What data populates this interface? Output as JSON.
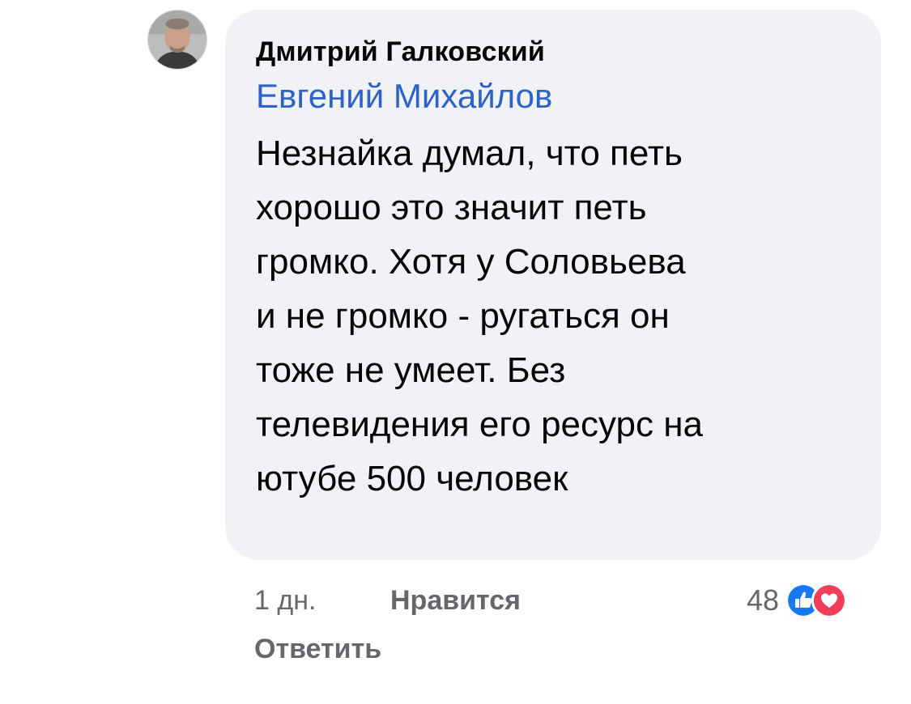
{
  "comment": {
    "author": "Дмитрий Галковский",
    "mention": "Евгений Михайлов",
    "text": "Незнайка думал, что петь\nхорошо это значит петь\nгромко. Хотя у Соловьева\nи не громко - ругаться он\nтоже не умеет. Без\nтелевидения его ресурс на\nютубе 500 человек"
  },
  "meta": {
    "time": "1 дн.",
    "like_label": "Нравится",
    "reply_label": "Ответить",
    "reaction_count": "48",
    "reactions": [
      "like-icon",
      "love-icon"
    ]
  },
  "colors": {
    "bubble_bg": "#f0f2f5",
    "mention": "#2d62c7",
    "like_blue": "#1877f2",
    "love_red": "#f33e58",
    "meta_gray": "#65676b"
  }
}
